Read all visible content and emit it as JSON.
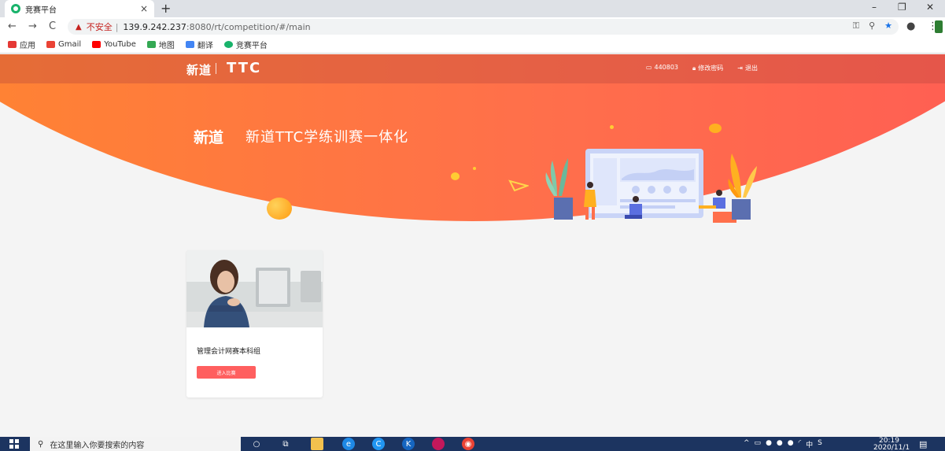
{
  "browser": {
    "tab_title": "竞赛平台",
    "tab_close": "×",
    "new_tab": "+",
    "url_warning_icon": "warning-triangle-icon",
    "insecure_label": "不安全",
    "url_separator": "|",
    "url_host": "139.9.242.237",
    "url_rest": ":8080/rt/competition/#/main",
    "win_min": "–",
    "win_restore": "❐",
    "win_close": "✕",
    "back": "←",
    "forward": "→",
    "reload": "C",
    "icon_key": "⚿",
    "icon_zoom": "⚲",
    "icon_star": "★",
    "icon_account": "●",
    "icon_menu": "⋮"
  },
  "bookmarks": [
    {
      "label": "应用",
      "color": "#e53935"
    },
    {
      "label": "Gmail",
      "color": "#ea4335"
    },
    {
      "label": "YouTube",
      "color": "#ff0000"
    },
    {
      "label": "地图",
      "color": "#34a853"
    },
    {
      "label": "翻译",
      "color": "#4285f4"
    },
    {
      "label": "竞赛平台",
      "color": "#19b36b"
    }
  ],
  "site": {
    "logo_small": "新道",
    "logo_ttc": "TTC",
    "nav": {
      "user_id": "440803",
      "change_password": "修改密码",
      "logout": "退出"
    },
    "hero_logo": "新道",
    "hero_title": "新道TTC学练训赛一体化"
  },
  "card": {
    "title": "管理会计网赛本科组",
    "button": "进入比赛"
  },
  "taskbar": {
    "search_placeholder": "在这里输入你要搜索的内容",
    "time": "20:19",
    "date": "2020/11/1",
    "lang": "中",
    "tray_caret": "^"
  },
  "colors": {
    "hero_start": "#ff8a2a",
    "hero_end": "#ff5757",
    "button": "#ff5f5f",
    "taskbar": "#1c3460"
  }
}
